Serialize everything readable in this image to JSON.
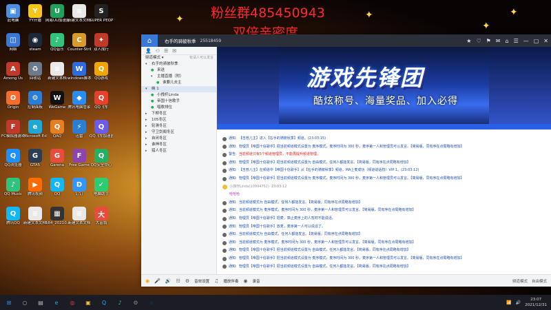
{
  "overlay": {
    "line1": "粉丝群485450943",
    "line2": "双倍亲密度"
  },
  "desktop_icons": [
    {
      "label": "此电脑",
      "color": "#4a90e2",
      "glyph": "▣"
    },
    {
      "label": "YY开播",
      "color": "#f5c518",
      "glyph": "Y"
    },
    {
      "label": "网易UU加速器",
      "color": "#1fa15a",
      "glyph": "U"
    },
    {
      "label": "新建文本文档(2)",
      "color": "#e9e9e9",
      "glyph": "≡"
    },
    {
      "label": "SUPER PEOPLE CBT",
      "color": "#222",
      "glyph": "S"
    },
    {
      "label": "网络",
      "color": "#3a78d8",
      "glyph": "◫"
    },
    {
      "label": "steam",
      "color": "#1b2838",
      "glyph": "◉"
    },
    {
      "label": "QQ音乐",
      "color": "#31c27c",
      "glyph": "♪"
    },
    {
      "label": "Counter-Strike Global Off...",
      "color": "#d89a2a",
      "glyph": "C"
    },
    {
      "label": "双人成行",
      "color": "#c0392b",
      "glyph": "✦"
    },
    {
      "label": "Among Us",
      "color": "#c0392b",
      "glyph": "A"
    },
    {
      "label": "回收站",
      "color": "#6b7b8c",
      "glyph": "♻"
    },
    {
      "label": "新建文本档",
      "color": "#e9e9e9",
      "glyph": "≡"
    },
    {
      "label": "windows脚本录制工具",
      "color": "#2d6cdf",
      "glyph": "W"
    },
    {
      "label": "QQ游戏",
      "color": "#f0a500",
      "glyph": "Q"
    },
    {
      "label": "Origin",
      "color": "#f56c2d",
      "glyph": "O"
    },
    {
      "label": "控制面板",
      "color": "#2a7fd4",
      "glyph": "⚙"
    },
    {
      "label": "WeGame",
      "color": "#111",
      "glyph": "W"
    },
    {
      "label": "腾讯电脑管家",
      "color": "#2b8cf0",
      "glyph": "◆"
    },
    {
      "label": "QQ飞车",
      "color": "#e5412d",
      "glyph": "Q"
    },
    {
      "label": "FC模拟器游戏合集",
      "color": "#c0392b",
      "glyph": "F"
    },
    {
      "label": "Microsoft Edge",
      "color": "#1fa7d6",
      "glyph": "e"
    },
    {
      "label": "QAQ",
      "color": "#e67e22",
      "glyph": "Q"
    },
    {
      "label": "迅雷",
      "color": "#2a7fd4",
      "glyph": "⚡"
    },
    {
      "label": "QQ飞车加速器",
      "color": "#6c5ce7",
      "glyph": "Q"
    },
    {
      "label": "QQ浏览器",
      "color": "#1e90ff",
      "glyph": "Q"
    },
    {
      "label": "GTA5",
      "color": "#2c3e50",
      "glyph": "G"
    },
    {
      "label": "Garena",
      "color": "#e74c3c",
      "glyph": "G"
    },
    {
      "label": "Free Game",
      "color": "#8e44ad",
      "glyph": "F"
    },
    {
      "label": "QQ安全中心",
      "color": "#27ae60",
      "glyph": "Q"
    },
    {
      "label": "QQ Music",
      "color": "#31c27c",
      "glyph": "♪"
    },
    {
      "label": "腾讯视频",
      "color": "#ff6b00",
      "glyph": "▶"
    },
    {
      "label": "QQ",
      "color": "#12b7f5",
      "glyph": "Q"
    },
    {
      "label": "钉钉",
      "color": "#3296fa",
      "glyph": "D"
    },
    {
      "label": "电脑助手",
      "color": "#2ecc71",
      "glyph": "✓"
    },
    {
      "label": "腾讯QQ",
      "color": "#12b7f5",
      "glyph": "Q"
    },
    {
      "label": "新建文本文档(3)",
      "color": "#e9e9e9",
      "glyph": "≡"
    },
    {
      "label": "584_20210...",
      "color": "#333",
      "glyph": "▦"
    },
    {
      "label": "新建文本文档",
      "color": "#e9e9e9",
      "glyph": "≡"
    },
    {
      "label": "大富翁",
      "color": "#e74c3c",
      "glyph": "大"
    }
  ],
  "window": {
    "title": "右手的骑彼秋季",
    "room_id": "25518459",
    "tools": [
      "★",
      "♡",
      "⚑",
      "✉",
      "⌂",
      "☰",
      "—",
      "▢",
      "✕"
    ]
  },
  "sidebar": {
    "header_left": "频道模式 ▾",
    "header_right": "有请人可以发言",
    "items": [
      {
        "text": "右手的骑彼秋季",
        "tri": "▾",
        "level": 0,
        "selected": false
      },
      {
        "text": "来送",
        "tri": "",
        "level": 1,
        "selected": false
      },
      {
        "text": "主播直播（附）",
        "tri": "▾",
        "level": 1,
        "selected": false
      },
      {
        "text": "谁要儿去主",
        "tri": "",
        "level": 2,
        "selected": false
      },
      {
        "text": "纳 1",
        "tri": "▾",
        "level": 0,
        "selected": true
      },
      {
        "text": "小拽杆Linda",
        "tri": "",
        "level": 1,
        "selected": false
      },
      {
        "text": "帝国十信歌手",
        "tri": "",
        "level": 1,
        "selected": false
      },
      {
        "text": "唱歌排位",
        "tri": "",
        "level": 1,
        "selected": false
      },
      {
        "text": "下柳冬区",
        "tri": "▸",
        "level": 0,
        "selected": false
      },
      {
        "text": "105冬区",
        "tri": "▸",
        "level": 0,
        "selected": false
      },
      {
        "text": "轮滑冬区",
        "tri": "▸",
        "level": 0,
        "selected": false
      },
      {
        "text": "守卫剑阁冬区",
        "tri": "▸",
        "level": 0,
        "selected": false
      },
      {
        "text": "自闭冬区",
        "tri": "▸",
        "level": 0,
        "selected": false
      },
      {
        "text": "谁神冬区",
        "tri": "▸",
        "level": 0,
        "selected": false
      },
      {
        "text": "猎人冬区",
        "tri": "▸",
        "level": 0,
        "selected": false
      }
    ]
  },
  "banner": {
    "title": "游戏先锋团",
    "subtitle": "酷炫称号、海量奖品、加入必得"
  },
  "messages": [
    {
      "type": "sys",
      "label": "通知:",
      "text": "【吉普儿主】进入【右手的骑彼秋季】频道。(23:03:15)",
      "red": false
    },
    {
      "type": "sys",
      "label": "通知:",
      "text": "管理员【帝国十信歌手】把当前频道模式设置为 麦序模式，麦序时间为 300 秒，麦序第一人和管理员可以发言。【简易版，同有序在点局略有增加】",
      "red": false
    },
    {
      "type": "sys",
      "label": "警告:",
      "text": "当前频道只有5个频道管理员，不能再提升频道管理。",
      "red": true
    },
    {
      "type": "sys",
      "label": "通知:",
      "text": "管理员【帝国十信歌手】把当前频道模式设置为 自由模式，任何人都能发言。【简易版，同有序在点局略有增加】",
      "red": false
    },
    {
      "type": "sys",
      "label": "通知:",
      "text": "【吉普儿主】在频道中【帝国十信歌手】从【右手的骑彼秋季】频道，MA上麦成功（频道说话权）VIP 1。(23:03:12)",
      "red": false
    },
    {
      "type": "sys",
      "label": "通知:",
      "text": "管理员【帝国十信歌手】把当前频道模式设置为 麦序模式，麦序时间为 300 秒，麦序第一人和管理员可以发言。【简易版，同有序在点局略有增加】",
      "red": false
    },
    {
      "type": "user",
      "label": "小拽杆Linda(10994752)",
      "text": "23:03:12",
      "red": false
    },
    {
      "type": "mine",
      "label": "",
      "text": "哈哈哈",
      "red": false
    },
    {
      "type": "sys",
      "label": "通知:",
      "text": "当前频道模式为 自由模式，任何人都能发言。【简易版，同有序在点局略有增加】",
      "red": false
    },
    {
      "type": "sys",
      "label": "通知:",
      "text": "当前频道模式为 麦序模式，麦序时间为 300 秒，麦序第一人和管理员可以发言。【简易版，同有序在点局略有增加】",
      "red": false
    },
    {
      "type": "sys",
      "label": "通知:",
      "text": "管理员【帝国十信歌手】把麦，禁止麦序上的人暂时不能说话。",
      "red": false
    },
    {
      "type": "sys",
      "label": "通知:",
      "text": "管理员【帝国十信歌手】放麦，麦序第一人可以说话了。",
      "red": false
    },
    {
      "type": "sys",
      "label": "通知:",
      "text": "当前频道模式为 自由模式，任何人都能发言。【简易版，同有序在点局略有增加】",
      "red": false
    },
    {
      "type": "sys",
      "label": "通知:",
      "text": "当前频道模式为 麦序模式，麦序时间为 300 秒，麦序第一人和管理员可以发言。【简易版，同有序在点局略有增加】",
      "red": false
    },
    {
      "type": "sys",
      "label": "通知:",
      "text": "管理员【帝国十信歌手】把当前频道模式设置为 自由模式，任何人都能发言。【简易版，同有序在点局略有增加】",
      "red": false
    },
    {
      "type": "sys",
      "label": "通知:",
      "text": "管理员【帝国十信歌手】把当前频道模式设置为 麦序模式，麦序时间为 300 秒，麦序第一人和管理员可以发言。【简易版，同有序在点局略有增加】",
      "red": false
    },
    {
      "type": "sys",
      "label": "通知:",
      "text": "管理员【帝国十信歌手】把当前频道模式设置为 自由模式，任何人都能发言。【简易版，同有序在点局略有增加】",
      "red": false
    }
  ],
  "input": {
    "placeholder": "说点什么吧..."
  },
  "bottombar": {
    "volume_label": "音效设置",
    "music_label": "播放伴奏",
    "record_label": "录音",
    "mode_label": "频道模式",
    "right_label": "自由模式"
  },
  "taskbar": {
    "time": "23:07",
    "date": "2021/12/31",
    "icons": [
      "⊞",
      "○",
      "▤",
      "e",
      "◎",
      "▣",
      "Q",
      "♪",
      "⚙",
      "◉"
    ]
  }
}
